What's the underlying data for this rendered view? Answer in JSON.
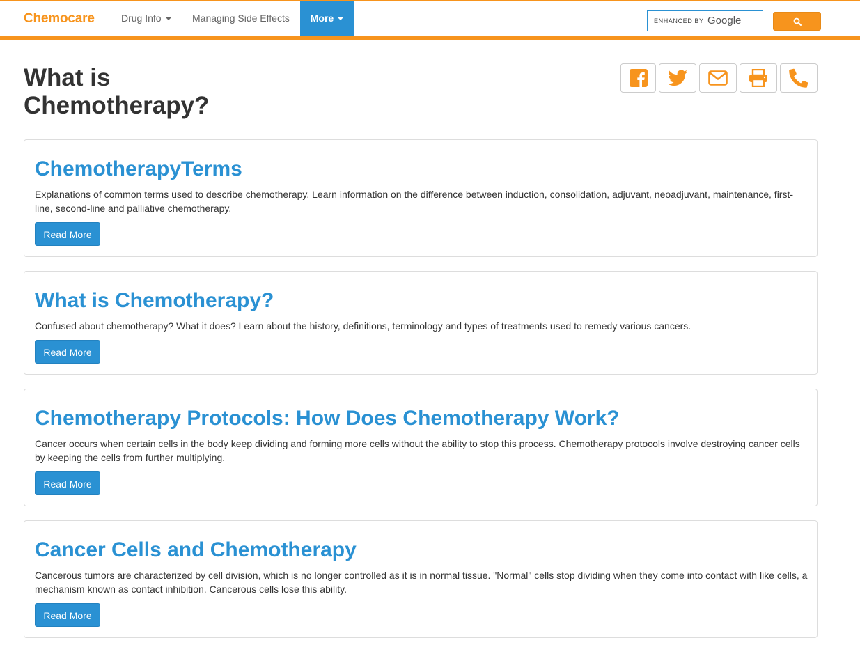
{
  "brand": {
    "name": "Chemocare",
    "color": "#f7941d"
  },
  "nav": {
    "items": [
      {
        "label": "Drug Info",
        "dropdown": true
      },
      {
        "label": "Managing Side Effects",
        "dropdown": false
      },
      {
        "label": "More",
        "dropdown": true,
        "active": true
      }
    ]
  },
  "search": {
    "enhanced_label": "ENHANCED BY",
    "provider": "Google",
    "button_icon": "search-icon"
  },
  "page": {
    "title": "What is Chemotherapy?"
  },
  "share": [
    {
      "icon": "facebook-icon"
    },
    {
      "icon": "twitter-icon"
    },
    {
      "icon": "envelope-icon"
    },
    {
      "icon": "print-icon"
    },
    {
      "icon": "phone-icon"
    }
  ],
  "cards": [
    {
      "title": "ChemotherapyTerms",
      "text": "Explanations of common terms used to describe chemotherapy. Learn information on the difference between induction, consolidation, adjuvant, neoadjuvant, maintenance, first-line, second-line and palliative chemotherapy.",
      "button": "Read More"
    },
    {
      "title": "What is Chemotherapy?",
      "text": "Confused about chemotherapy? What it does? Learn about the history, definitions, terminology and types of treatments used to remedy various cancers.",
      "button": "Read More"
    },
    {
      "title": "Chemotherapy Protocols: How Does Chemotherapy Work?",
      "text": "Cancer occurs when certain cells in the body keep dividing and forming more cells without the ability to stop this process. Chemotherapy protocols involve destroying cancer cells by keeping the cells from further multiplying.",
      "button": "Read More"
    },
    {
      "title": "Cancer Cells and Chemotherapy",
      "text": "Cancerous tumors are characterized by cell division, which is no longer controlled as it is in normal tissue. \"Normal\" cells stop dividing when they come into contact with like cells, a mechanism known as contact inhibition. Cancerous cells lose this ability.",
      "button": "Read More"
    }
  ],
  "colors": {
    "accent": "#f7941d",
    "link": "#2a91d3"
  }
}
